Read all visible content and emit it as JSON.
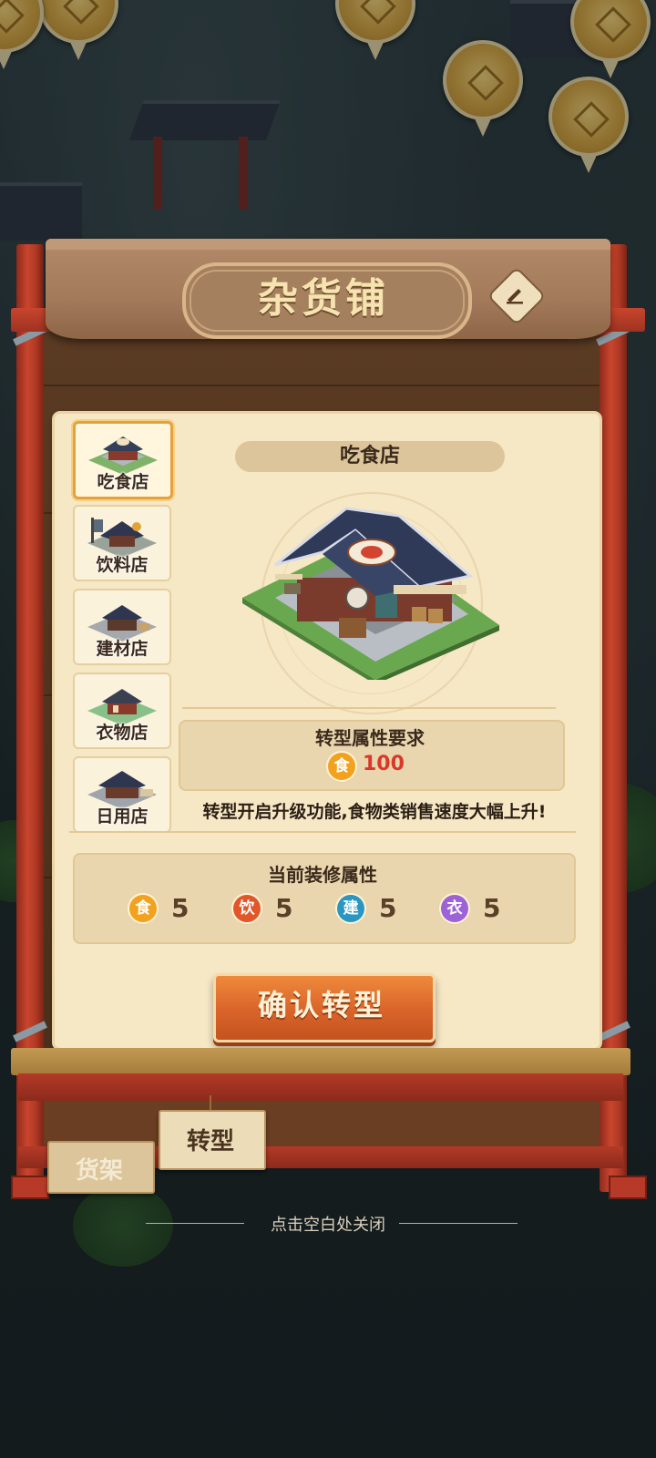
{
  "header": {
    "title": "杂货铺"
  },
  "tabs": [
    {
      "label": "吃食店",
      "selected": true
    },
    {
      "label": "饮料店",
      "selected": false
    },
    {
      "label": "建材店",
      "selected": false
    },
    {
      "label": "衣物店",
      "selected": false
    },
    {
      "label": "日用店",
      "selected": false
    }
  ],
  "selected_shop": {
    "name": "吃食店"
  },
  "requirement": {
    "title": "转型属性要求",
    "icon_text": "食",
    "value": "100"
  },
  "description": "转型开启升级功能,食物类销售速度大幅上升!",
  "current_attributes": {
    "title": "当前装修属性",
    "items": [
      {
        "icon_text": "食",
        "value": "5",
        "color": "#f2a21e"
      },
      {
        "icon_text": "饮",
        "value": "5",
        "color": "#e2572a"
      },
      {
        "icon_text": "建",
        "value": "5",
        "color": "#2a97c2"
      },
      {
        "icon_text": "衣",
        "value": "5",
        "color": "#9c62d6"
      }
    ]
  },
  "confirm_button": "确认转型",
  "bottom_tabs": {
    "shelf": "货架",
    "transform": "转型"
  },
  "close_hint": "点击空白处关闭",
  "colors": {
    "accent": "#d9632a",
    "requirement_value": "#d9382a",
    "frame_red": "#b33a27"
  }
}
